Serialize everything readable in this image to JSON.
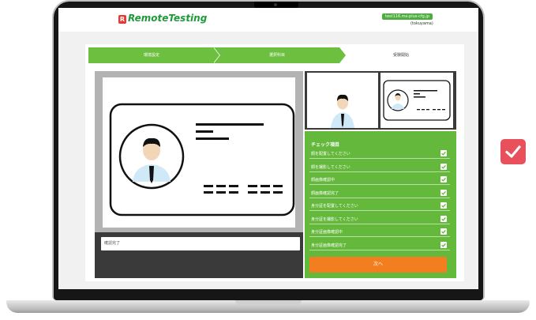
{
  "header": {
    "logo_mark": "R",
    "logo_text": "RemoteTesting",
    "user_email": "test116.ms-plus-cfg.jp",
    "user_name": "(tokuyama)"
  },
  "steps": [
    {
      "label": "環境設定",
      "active": true
    },
    {
      "label": "選択科目",
      "active": true
    },
    {
      "label": "受験開始",
      "active": false
    }
  ],
  "status_field": {
    "value": "確認完了"
  },
  "checklist": {
    "title": "チェック項目",
    "items": [
      {
        "label": "顔を配置してください",
        "checked": true
      },
      {
        "label": "顔を撮影してください",
        "checked": true
      },
      {
        "label": "顔画像確認中",
        "checked": true
      },
      {
        "label": "顔画像確認完了",
        "checked": true
      },
      {
        "label": "身分証を配置してください",
        "checked": true
      },
      {
        "label": "身分証を撮影してください",
        "checked": true
      },
      {
        "label": "身分証画像確認中",
        "checked": true
      },
      {
        "label": "身分証画像確認完了",
        "checked": true
      }
    ]
  },
  "next_button": {
    "label": "次へ"
  },
  "floating_badge": {
    "icon": "check-icon",
    "color": "#e8515b"
  },
  "colors": {
    "accent_green": "#64b83b",
    "accent_orange": "#f27e1f",
    "brand_red": "#e53935"
  },
  "icons": [
    "check-icon",
    "person-avatar",
    "id-card"
  ]
}
